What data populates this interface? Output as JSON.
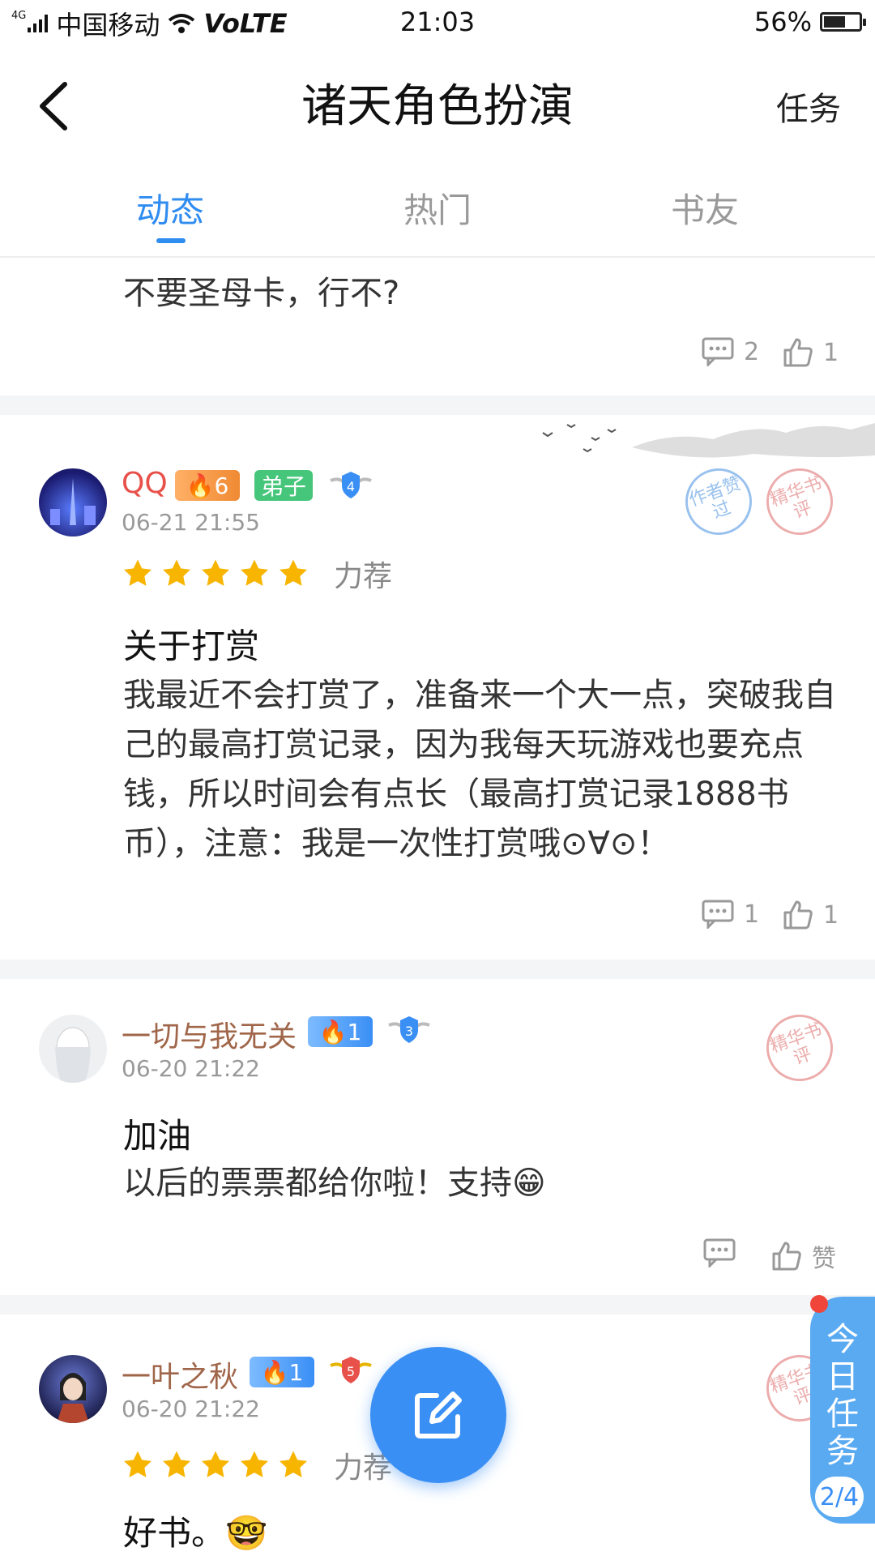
{
  "status_bar": {
    "network_type": "4G",
    "carrier": "中国移动",
    "volte": "VoLTE",
    "time": "21:03",
    "battery": "56%"
  },
  "header": {
    "title": "诸天角色扮演",
    "task_label": "任务"
  },
  "tabs": [
    {
      "label": "动态",
      "active": true
    },
    {
      "label": "热门",
      "active": false
    },
    {
      "label": "书友",
      "active": false
    }
  ],
  "posts": [
    {
      "text": "不要圣母卡，行不?",
      "replies": "2",
      "likes": "1"
    },
    {
      "username": "QQ",
      "fan_level": "6",
      "role_badge": "弟子",
      "shield_level": "4",
      "time": "06-21 21:55",
      "rating_label": "力荐",
      "stars": 5,
      "title": "关于打赏",
      "text": "我最近不会打赏了，准备来一个大一点，突破我自己的最高打赏记录，因为我每天玩游戏也要充点钱，所以时间会有点长（最高打赏记录1888书币），注意：我是一次性打赏哦⊙∀⊙！",
      "replies": "1",
      "likes": "1",
      "stamps": [
        "作者赞过",
        "精华书评"
      ]
    },
    {
      "username": "一切与我无关",
      "fan_level": "1",
      "shield_level": "3",
      "time": "06-20 21:22",
      "title": "加油",
      "text": "以后的票票都给你啦！支持😁",
      "like_label": "赞",
      "stamps": [
        "精华书评"
      ]
    },
    {
      "username": "一叶之秋",
      "fan_level": "1",
      "shield_level": "5",
      "time": "06-20 21:22",
      "rating_label": "力荐",
      "stars": 5,
      "title": "好书。🤓",
      "stamps": [
        "精华书评"
      ]
    }
  ],
  "daily_task": {
    "label": "今日任务",
    "progress": "2/4"
  },
  "colors": {
    "accent": "#2f8cf0",
    "username_red": "#e8504a",
    "username_brown": "#a0664a",
    "badge_fire_orange": "#f08a33",
    "badge_green": "#46c67a",
    "badge_blue": "#3a8ff5",
    "star": "#f7b500"
  }
}
